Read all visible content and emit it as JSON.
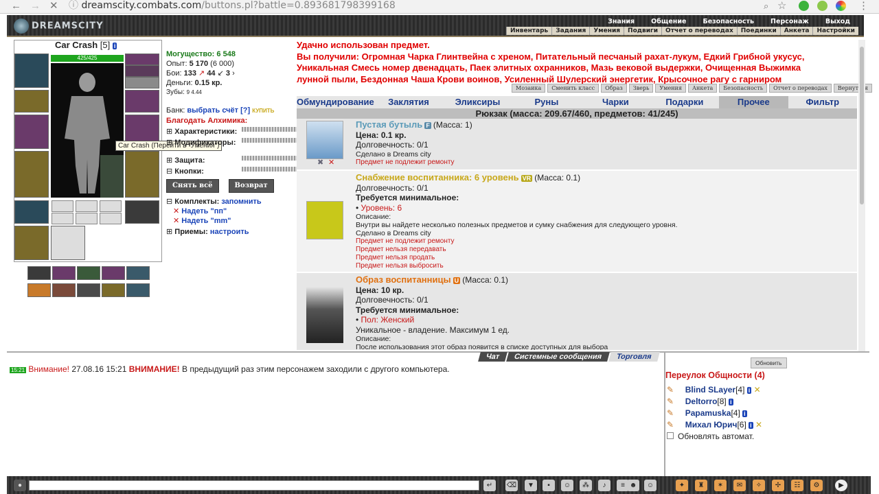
{
  "browser": {
    "url_host": "dreamscity.combats.com",
    "url_path": "/buttons.pl?battle=0.893681798399168"
  },
  "header": {
    "logo": "DREAMSCITY",
    "top_menu": [
      "Знания",
      "Общение",
      "Безопасность",
      "Персонаж",
      "Выход"
    ],
    "sub_menu": [
      "Инвентарь",
      "Задания",
      "Умения",
      "Подвиги",
      "Отчет о переводах",
      "Поединки",
      "Анкета",
      "Настройки"
    ]
  },
  "character": {
    "name": "Car Crash",
    "level": "[5]",
    "hp": "425/425",
    "tooltip": "Car Crash (Перейти в \"Умения\")"
  },
  "stats": {
    "power_label": "Могущество:",
    "power": "6 548",
    "exp_label": "Опыт:",
    "exp": "5 170",
    "exp_next": "(6 000)",
    "fights_label": "Бои:",
    "wins": "133",
    "losses": "44",
    "draws": "3",
    "money_label": "Деньги:",
    "money": "0.15 кр.",
    "teeth_label": "Зубы:",
    "teeth": "9 4.44",
    "bank_label": "Банк:",
    "bank_link": "выбрать счёт",
    "bank_help": "[?]",
    "bank_buy": "КУПИТЬ",
    "blessing": "Благодать Алхимика:",
    "sections": [
      "Характеристики:",
      "Модификаторы:",
      "Защита:",
      "Кнопки:"
    ],
    "btn_remove": "Снять всё",
    "btn_return": "Возврат",
    "sets_label": "Комплекты:",
    "sets_remember": "запомнить",
    "set1": "Надеть \"пп\"",
    "set2": "Надеть \"mm\"",
    "tricks_label": "Приемы:",
    "tricks_setup": "настроить"
  },
  "messages": [
    "Удачно использован предмет.",
    "Вы получили: Огромная Чарка Глинтвейна с хреном, Питательный песчаный рахат-лукум, Едкий Грибной укусус,",
    "Уникальная Смесь номер двенадцать, Паек элитных охранников, Мазь вековой выдержки, Очищенная Выжимка",
    "лунной пыли, Бездонная Чаша Крови воинов, Усиленный Шулерский энергетик, Крысочное рагу с гарниром"
  ],
  "tiny_buttons": [
    "Мозаика",
    "Сменить класс",
    "Образ",
    "Зверь",
    "Умения",
    "Анкета",
    "Безопасность",
    "Отчет о переводах",
    "Вернуться"
  ],
  "tabs": [
    "Обмундирование",
    "Заклятия",
    "Эликсиры",
    "Руны",
    "Чарки",
    "Подарки",
    "Прочее",
    "Фильтр"
  ],
  "active_tab": "Прочее",
  "backpack": "Рюкзак (масса: 209.67/460, предметов: 41/245)",
  "items": [
    {
      "title": "Пустая бутыль",
      "mass": "(Масса: 1)",
      "price": "Цена: 0.1 кр.",
      "durability": "Долговечность: 0/1",
      "made": "Сделано в Dreams city",
      "warn": [
        "Предмет не подлежит ремонту"
      ]
    },
    {
      "title": "Снабжение воспитанника: 6 уровень",
      "badge": "VR",
      "mass": "(Масса: 0.1)",
      "durability": "Долговечность: 0/1",
      "req": "Требуется минимальное:",
      "req_item": "Уровень: 6",
      "desc_label": "Описание:",
      "desc": "Внутри вы найдете несколько полезных предметов и сумку снабжения для следующего уровня.",
      "made": "Сделано в Dreams city",
      "warn": [
        "Предмет не подлежит ремонту",
        "Предмет нельзя передавать",
        "Предмет нельзя продать",
        "Предмет нельзя выбросить"
      ]
    },
    {
      "title": "Образ воспитанницы",
      "badge": "U",
      "mass": "(Масса: 0.1)",
      "price": "Цена: 10 кр.",
      "durability": "Долговечность: 0/1",
      "req": "Требуется минимальное:",
      "req_item": "Пол: Женский",
      "unique": "Уникальное - владение. Максимум 1 ед.",
      "desc_label": "Описание:",
      "desc": "После использования этот образ появится в списке доступных для выбора"
    }
  ],
  "chat": {
    "tabs": [
      "Чат",
      "Системные сообщения",
      "Торговля"
    ],
    "time": "15:21",
    "attn": "Внимание!",
    "date": "27.08.16 15:21",
    "attn2": "ВНИМАНИЕ!",
    "text": "В предыдущий раз этим персонажем заходили с другого компьютера."
  },
  "location": {
    "refresh": "Обновить",
    "title": "Переулок Общности (4)",
    "users": [
      {
        "name": "Blind SLayer",
        "level": "[4]"
      },
      {
        "name": "Deltorro",
        "level": "[8]"
      },
      {
        "name": "Papamuska",
        "level": "[4]"
      },
      {
        "name": "Михал Юрич",
        "level": "[6]"
      }
    ],
    "auto": "Обновлять автомат."
  }
}
